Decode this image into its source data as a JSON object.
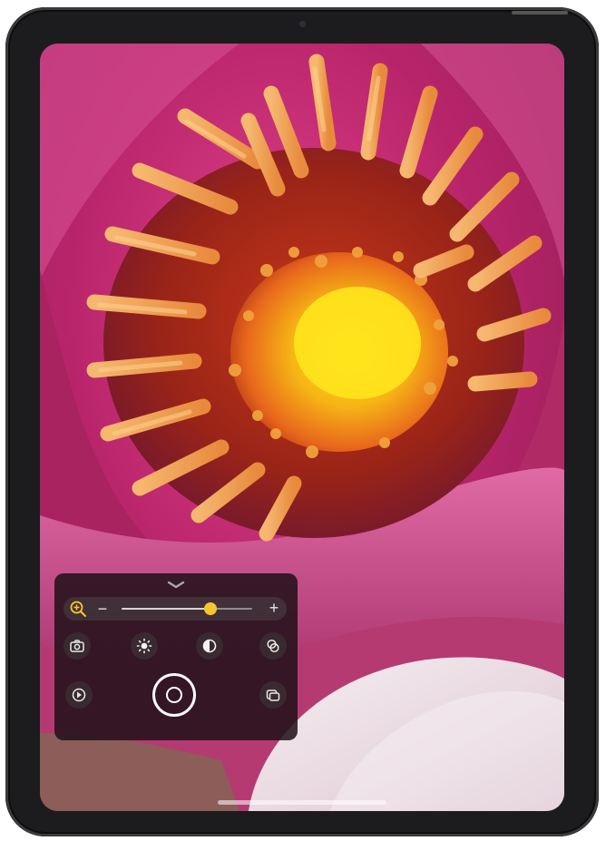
{
  "app": "Magnifier",
  "zoom": {
    "minus_label": "−",
    "plus_label": "+",
    "level": 0.68,
    "accent_color": "#f7c531"
  },
  "controls": {
    "row1": [
      "camera-icon",
      "brightness-icon",
      "contrast-icon",
      "filters-icon"
    ],
    "row2": [
      "flashlight-icon",
      "shutter-button",
      "multi-window-icon"
    ]
  },
  "colors": {
    "panel": "#201018",
    "accent": "#f7c531",
    "petal": "#c2306c",
    "pollen": "#f6c61a"
  }
}
